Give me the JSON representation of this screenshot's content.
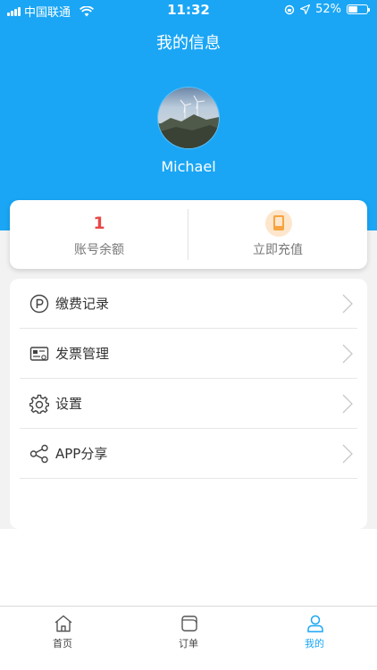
{
  "status_bar": {
    "carrier": "中国联通",
    "time": "11:32",
    "battery": "52%",
    "battery_level": 0.52
  },
  "page": {
    "title": "我的信息"
  },
  "profile": {
    "username": "Michael"
  },
  "balance_card": {
    "balance_value": "1",
    "balance_label": "账号余额",
    "recharge_label": "立即充值"
  },
  "menu": {
    "items": [
      {
        "label": "缴费记录",
        "icon": "parking-icon"
      },
      {
        "label": "发票管理",
        "icon": "invoice-icon"
      },
      {
        "label": "设置",
        "icon": "gear-icon"
      },
      {
        "label": "APP分享",
        "icon": "share-icon"
      }
    ]
  },
  "tabbar": {
    "tabs": [
      {
        "label": "首页",
        "icon": "home-icon"
      },
      {
        "label": "订单",
        "icon": "order-icon"
      },
      {
        "label": "我的",
        "icon": "user-icon",
        "active": true
      }
    ]
  },
  "colors": {
    "accent": "#1aa6f5",
    "balance": "#e94747",
    "recharge": "#f6a540"
  }
}
